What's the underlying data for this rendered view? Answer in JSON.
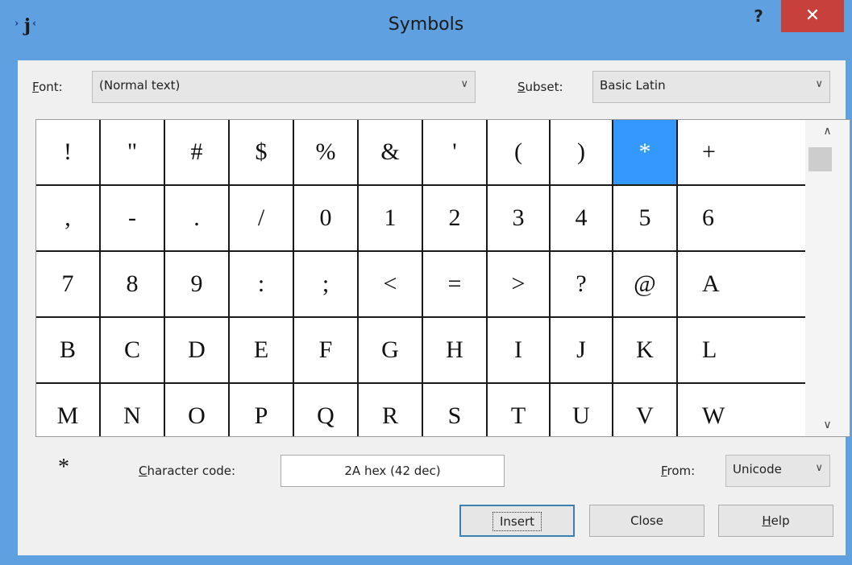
{
  "window": {
    "title": "Symbols",
    "help_glyph": "?",
    "close_glyph": "✕"
  },
  "font_label": "Font:",
  "font_value": "(Normal text)",
  "subset_label": "Subset:",
  "subset_value": "Basic Latin",
  "dropdown_arrow": "∨",
  "grid": {
    "rows": [
      [
        "!",
        "\"",
        "#",
        "$",
        "%",
        "&",
        "'",
        "(",
        ")",
        "*",
        "+"
      ],
      [
        ",",
        "-",
        ".",
        "/",
        "0",
        "1",
        "2",
        "3",
        "4",
        "5",
        "6"
      ],
      [
        "7",
        "8",
        "9",
        ":",
        ";",
        "<",
        "=",
        ">",
        "?",
        "@",
        "A"
      ],
      [
        "B",
        "C",
        "D",
        "E",
        "F",
        "G",
        "H",
        "I",
        "J",
        "K",
        "L"
      ],
      [
        "M",
        "N",
        "O",
        "P",
        "Q",
        "R",
        "S",
        "T",
        "U",
        "V",
        "W"
      ]
    ],
    "selected": "*"
  },
  "scroll": {
    "up": "∧",
    "down": "∨"
  },
  "preview_char": "*",
  "char_code_label": "Character code:",
  "char_code_value": "2A hex (42 dec)",
  "from_label": "From:",
  "from_value": "Unicode",
  "buttons": {
    "insert": "Insert",
    "close": "Close",
    "help": "Help"
  }
}
